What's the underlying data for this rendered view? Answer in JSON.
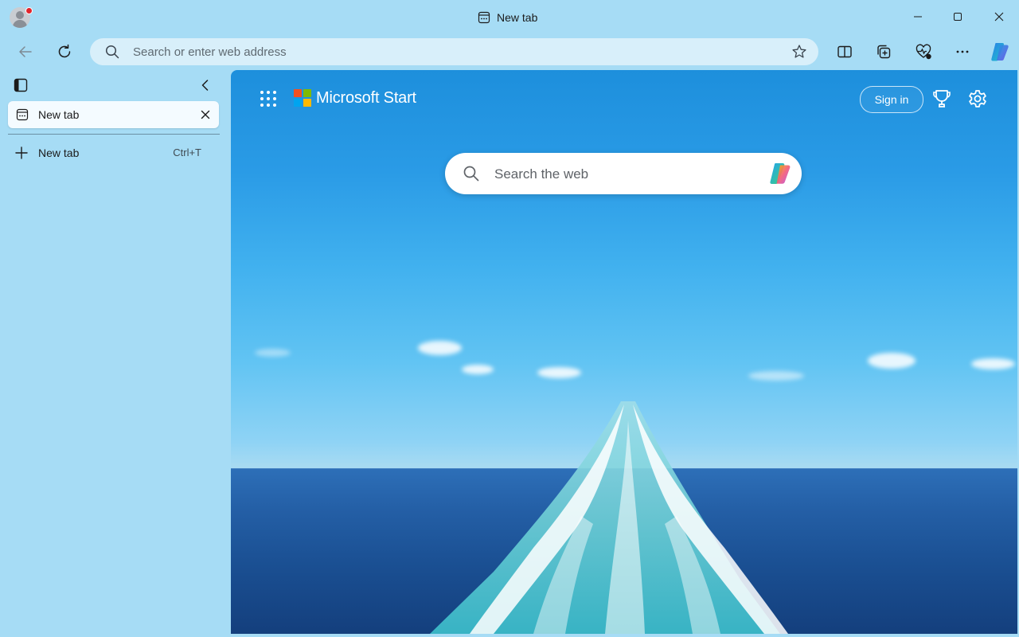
{
  "window": {
    "title": "New tab"
  },
  "toolbar": {
    "address_placeholder": "Search or enter web address"
  },
  "sidebar": {
    "tabs": [
      {
        "label": "New tab"
      }
    ],
    "new_tab": {
      "label": "New tab",
      "shortcut": "Ctrl+T"
    }
  },
  "page": {
    "brand": "Microsoft Start",
    "sign_in_label": "Sign in",
    "search_placeholder": "Search the web",
    "logo_colors": [
      "#f25022",
      "#7fba00",
      "#00a4ef",
      "#ffb900"
    ]
  },
  "icons": {
    "profile": "profile-avatar-icon",
    "back": "back-arrow-icon",
    "refresh": "refresh-icon",
    "favorite": "star-icon",
    "split": "split-screen-icon",
    "collections": "collections-icon",
    "performance": "heart-pulse-icon",
    "more": "more-dots-icon",
    "copilot": "copilot-icon",
    "apps": "apps-grid-icon",
    "rewards": "trophy-icon",
    "settings": "gear-icon"
  }
}
